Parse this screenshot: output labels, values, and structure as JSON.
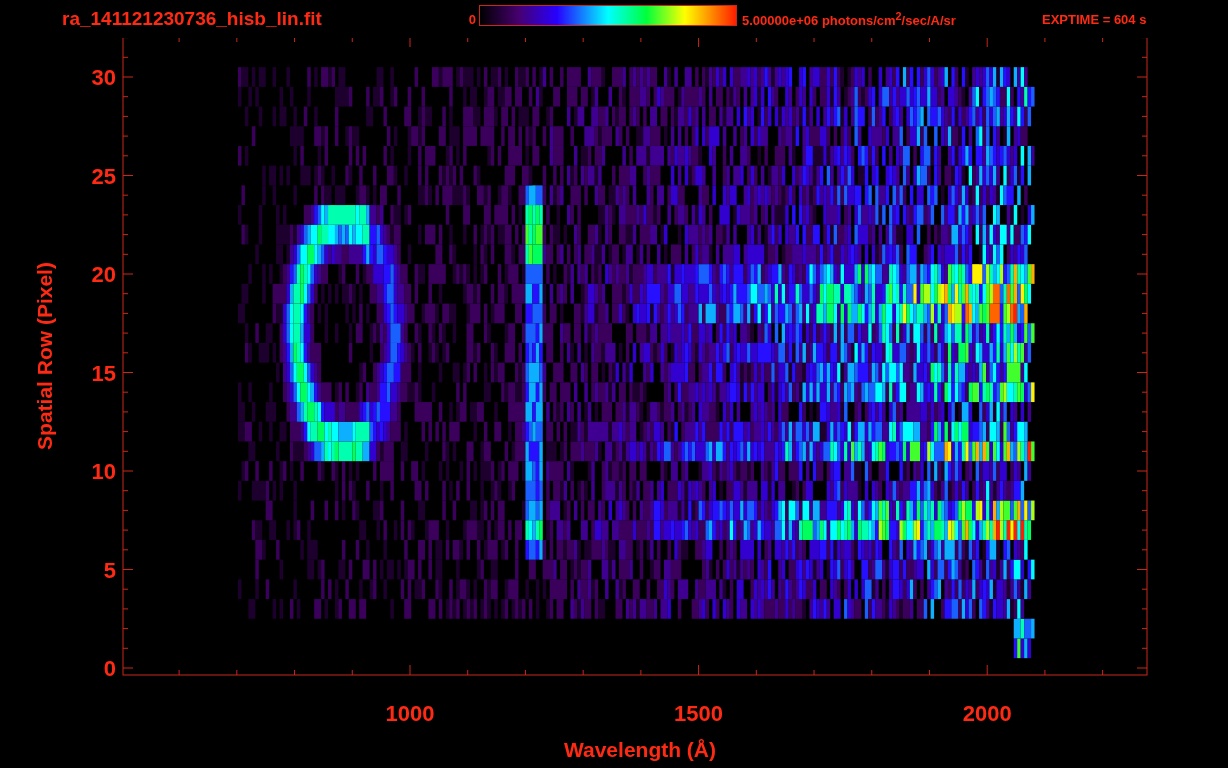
{
  "title": "ra_141121230736_hisb_lin.fit",
  "colorbar": {
    "min_label": "0",
    "max_label": "5.00000e+06 photons/cm$^{2}$/sec/A/sr"
  },
  "exposure": "EXPTIME = 604 s",
  "plot": {
    "xlabel": "Wavelength (Å)",
    "ylabel": "Spatial Row (Pixel)",
    "yticks": [
      "30",
      "25",
      "20",
      "15",
      "10",
      "5",
      "0"
    ],
    "xticks": [
      "1000",
      "1500",
      "2000"
    ]
  }
}
